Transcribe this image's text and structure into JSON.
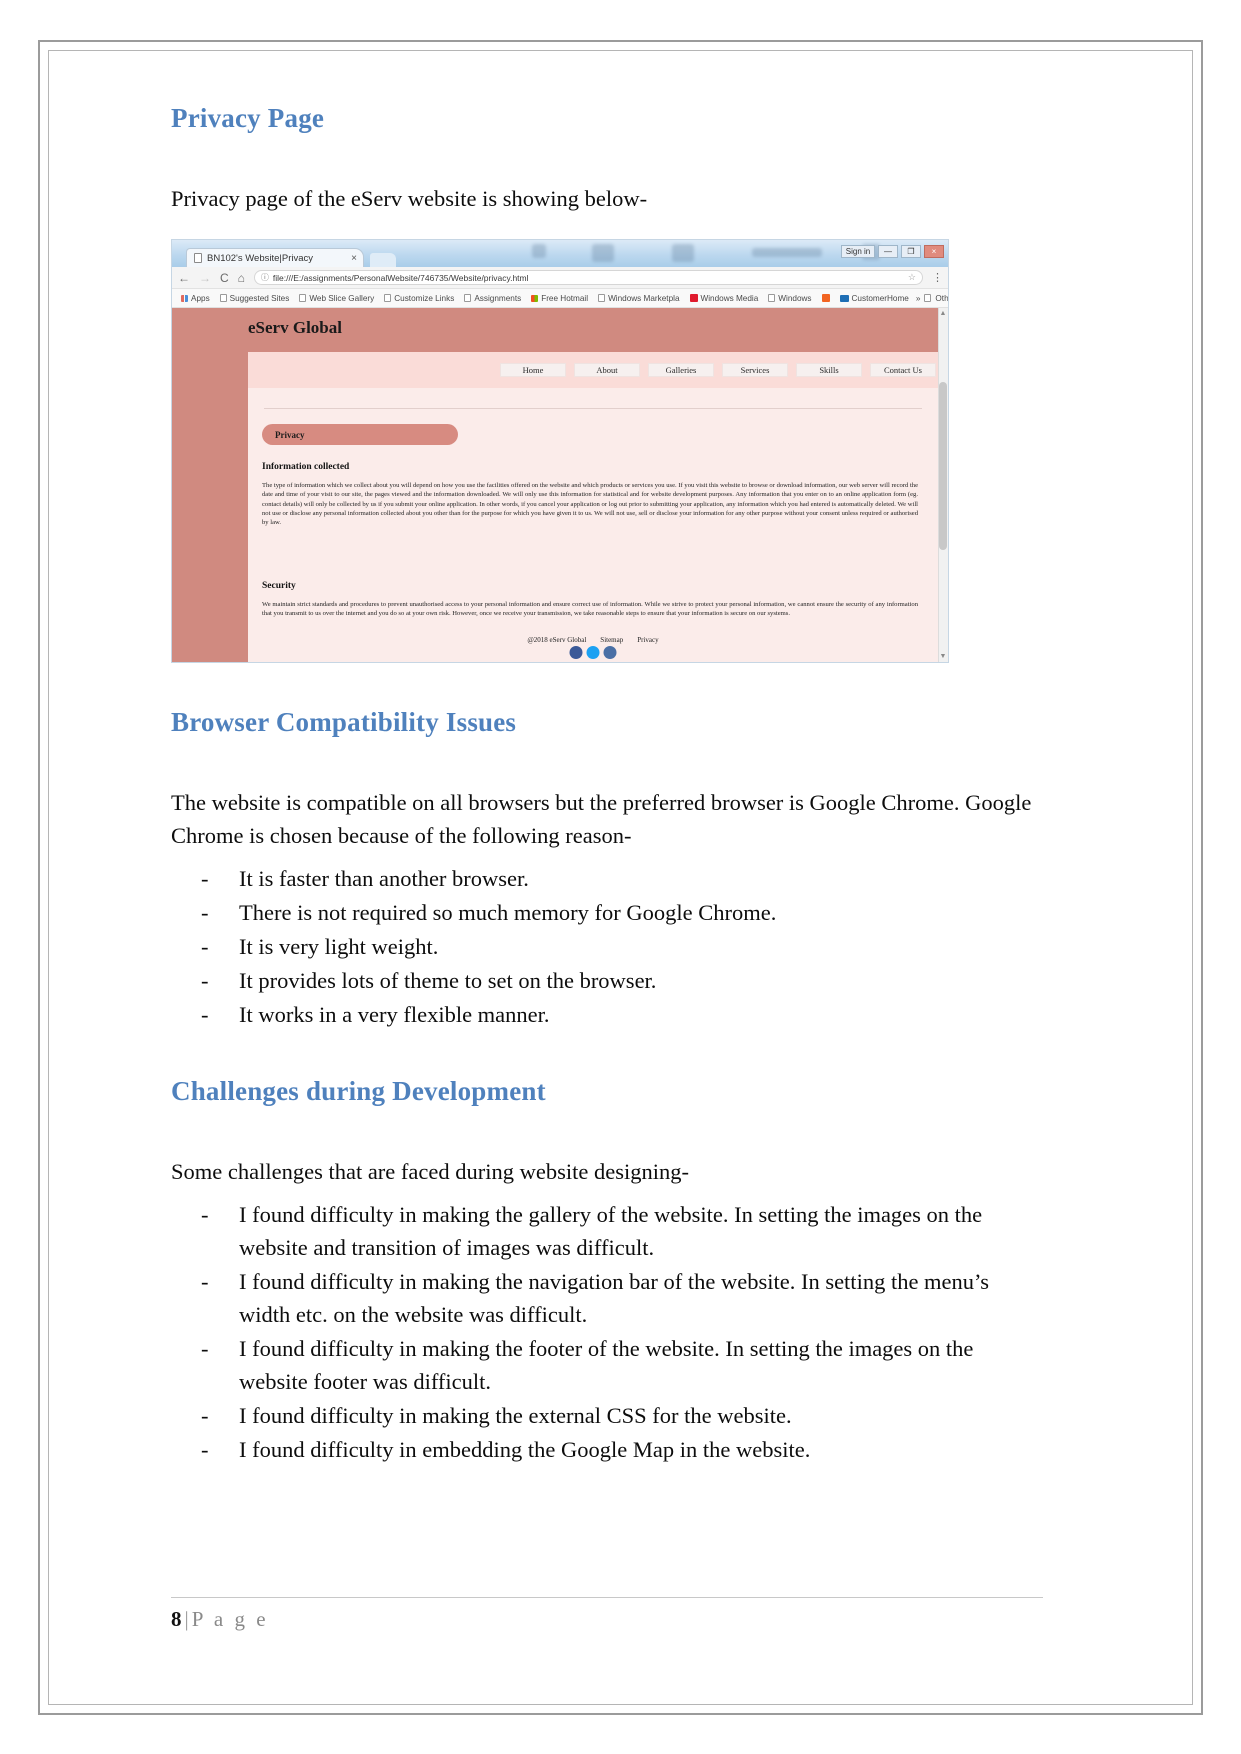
{
  "document": {
    "sections": [
      {
        "heading": "Privacy Page",
        "intro": "Privacy page of the eServ website is showing below-"
      },
      {
        "heading": "Browser Compatibility Issues",
        "intro": "The website is compatible on all browsers but the preferred browser is Google Chrome. Google Chrome is chosen because of the following reason-",
        "bullets": [
          "It is faster than another browser.",
          "There is not required so much memory for Google Chrome.",
          "It is very light weight.",
          "It provides lots of theme to set on the browser.",
          "It works in a very flexible manner."
        ]
      },
      {
        "heading": "Challenges during Development",
        "intro": "Some challenges that are faced during website designing-",
        "bullets": [
          "I found difficulty in making the gallery of the website. In setting the images on the website and transition of images was difficult.",
          "I found difficulty in making the navigation bar of the website. In setting the menu’s width etc. on the website was difficult.",
          "I found difficulty in making the footer of the website. In setting the images on the website footer was difficult.",
          "I found difficulty in making the external CSS for the website.",
          "I found difficulty in embedding the Google Map in the website."
        ]
      }
    ],
    "bullet_marker": "-",
    "footer": {
      "page_number": "8",
      "separator": "|",
      "page_word": "P a g e"
    },
    "heading_color": "#4f81bd"
  },
  "screenshot": {
    "browser": {
      "tab_title": "BN102's Website|Privacy",
      "tab_close": "×",
      "back": "←",
      "forward": "→",
      "reload": "C",
      "home": "⌂",
      "url": "file:///E:/assignments/PersonalWebsite/746735/Website/privacy.html",
      "url_info_icon": "ⓘ",
      "star": "☆",
      "menu": "⋮",
      "window_minimize": "—",
      "window_maximize": "❐",
      "window_close": "×",
      "window_signin": "Sign in",
      "bookmarks": [
        {
          "label": "Apps",
          "icon": "apps-grid-icon"
        },
        {
          "label": "Suggested Sites",
          "icon": "page-icon"
        },
        {
          "label": "Web Slice Gallery",
          "icon": "page-icon"
        },
        {
          "label": "Customize Links",
          "icon": "page-icon"
        },
        {
          "label": "Assignments",
          "icon": "page-icon"
        },
        {
          "label": "Free Hotmail",
          "icon": "microsoft-icon"
        },
        {
          "label": "Windows Marketpla",
          "icon": "page-icon"
        },
        {
          "label": "Windows Media",
          "icon": "media-icon"
        },
        {
          "label": "Windows",
          "icon": "page-icon"
        },
        {
          "label": "",
          "icon": "orange-icon"
        },
        {
          "label": "CustomerHome",
          "icon": "blue-icon"
        }
      ],
      "overflow": "»",
      "other_bookmarks": "Other bookmarks"
    },
    "site": {
      "logo": "eServ Global",
      "nav": [
        "Home",
        "About",
        "Galleries",
        "Services",
        "Skills",
        "Contact Us"
      ],
      "page_pill": "Privacy",
      "blocks": [
        {
          "heading": "Information collected",
          "text": "The type of information which we collect about you will depend on how you use the facilities offered on the website and which products or services you use. If you visit this website to browse or download information, our web server will record the date and time of your visit to our site, the pages viewed and the information downloaded. We will only use this information for statistical and for website development purposes. Any information that you enter on to an online application form (eg. contact details) will only be collected by us if you submit your online application. In other words, if you cancel your application or log out prior to submitting your application, any information which you had entered is automatically deleted. We will not use or disclose any personal information collected about you other than for the purpose for which you have given it to us. We will not use, sell or disclose your information for any other purpose without your consent unless required or authorised by law."
        },
        {
          "heading": "Security",
          "text": "We maintain strict standards and procedures to prevent unauthorised access to your personal information and ensure correct use of information. While we strive to protect your personal information, we cannot ensure the security of any information that you transmit to us over the internet and you do so at your own risk. However, once we receive your transmission, we take reasonable steps to ensure that your information is secure on our systems."
        }
      ],
      "footer_links": [
        "@2018 eServ Global",
        "Sitemap",
        "Privacy"
      ],
      "colors": {
        "header": "#d08a80",
        "body": "#fbecea",
        "nav": "#fadcd8",
        "pill": "#d78b81"
      }
    }
  }
}
